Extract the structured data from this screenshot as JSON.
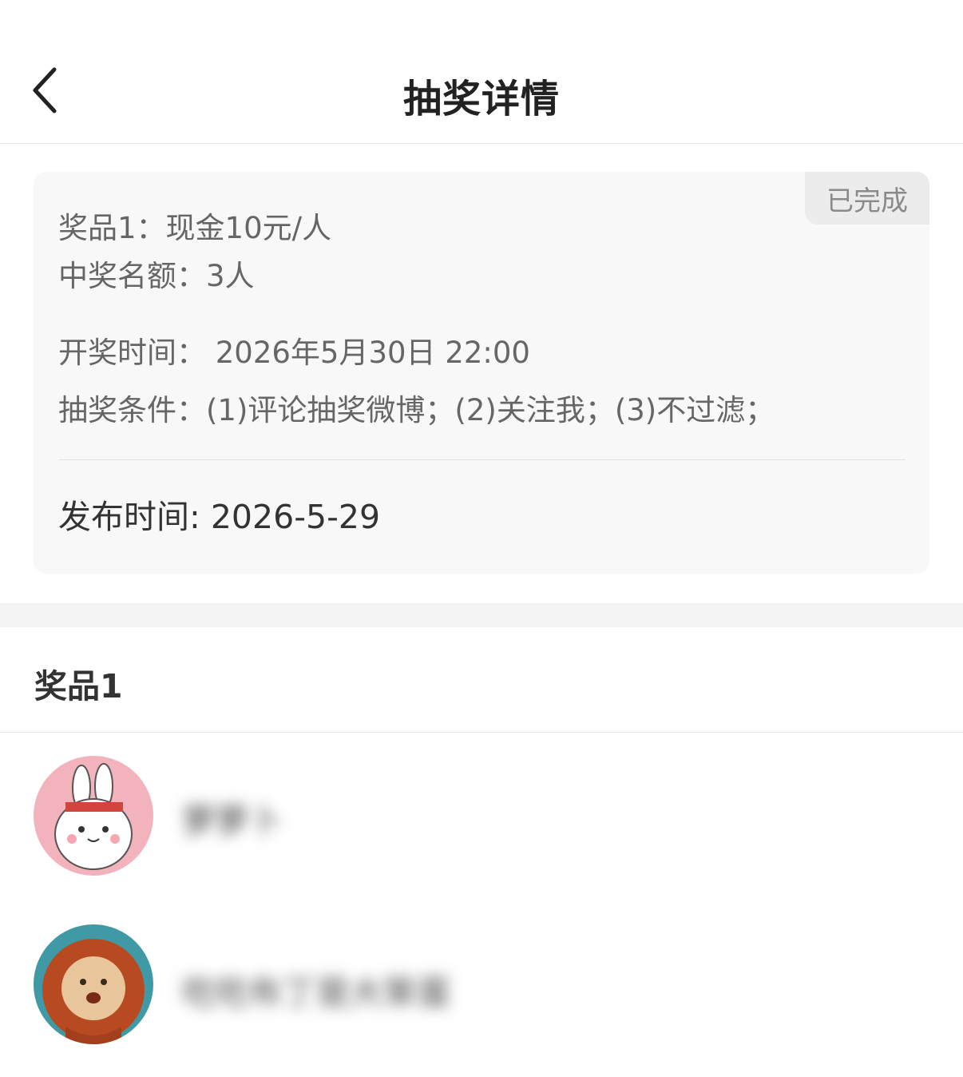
{
  "header": {
    "back_icon": "chevron-left-icon",
    "title": "抽奖详情"
  },
  "lottery": {
    "status": "已完成",
    "prize": "奖品1：现金10元/人",
    "quota": "中奖名额：3人",
    "draw_time": "开奖时间： 2026年5月30日 22:00",
    "conditions": "抽奖条件：(1)评论抽奖微博；(2)关注我；(3)不过滤；",
    "publish_time": "发布时间: 2026-5-29"
  },
  "prize_section": {
    "title": "奖品1",
    "winners": [
      {
        "name": "萝萝卜",
        "avatar_icon": "bunny-avatar"
      },
      {
        "name": "吃吃布丁是大笨蛋",
        "avatar_icon": "lion-avatar"
      }
    ]
  },
  "colors": {
    "card_bg": "#f8f8f8",
    "badge_bg": "#ececec",
    "avatar1_bg": "#f3b3bd",
    "avatar2_bg": "#3f9aa5"
  }
}
